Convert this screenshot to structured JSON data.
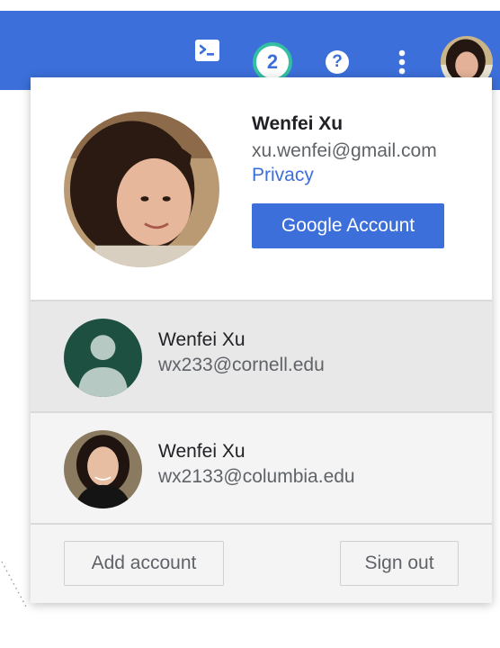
{
  "header": {
    "icons": [
      "terminal-icon",
      "notifications-badge",
      "help-icon",
      "more-vertical-icon",
      "user-avatar"
    ],
    "notification_count": "2",
    "help_glyph": "?",
    "accent_color": "#3c6fd9",
    "badge_ring_color": "#34bfa3"
  },
  "account_menu": {
    "primary": {
      "name": "Wenfei Xu",
      "email": "xu.wenfei@gmail.com",
      "privacy_label": "Privacy",
      "google_account_label": "Google Account"
    },
    "other_accounts": [
      {
        "name": "Wenfei Xu",
        "email": "wx233@cornell.edu",
        "avatar": "default-person-avatar"
      },
      {
        "name": "Wenfei Xu",
        "email": "wx2133@columbia.edu",
        "avatar": "photo-avatar"
      }
    ],
    "add_account_label": "Add account",
    "sign_out_label": "Sign out"
  }
}
